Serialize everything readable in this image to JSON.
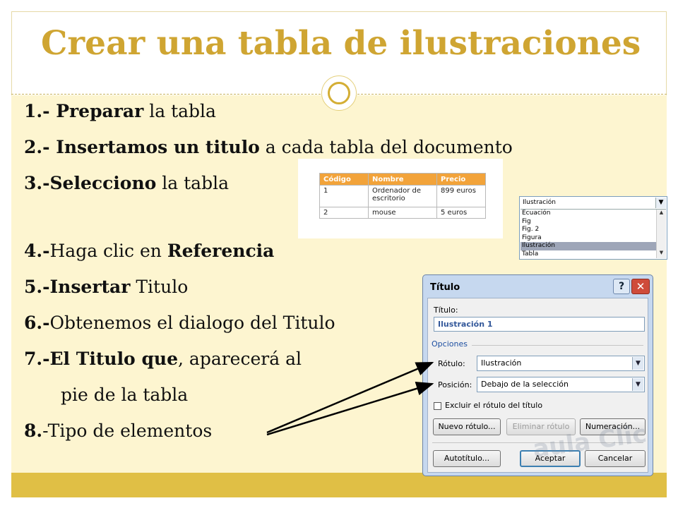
{
  "slide": {
    "title": "Crear una tabla de ilustraciones",
    "items": [
      {
        "number": "1.- ",
        "bold": "Preparar",
        "text": " la tabla"
      },
      {
        "number": "2.- ",
        "bold": "Insertamos un titulo",
        "text": " a cada tabla del documento"
      },
      {
        "number": "3.-",
        "bold": "Selecciono",
        "text": " la tabla"
      },
      {
        "number": "4.-",
        "text": "Haga clic en ",
        "bold_after": "Referencia"
      },
      {
        "number": "5.-",
        "bold": "Insertar",
        "text": " Titulo"
      },
      {
        "number": "6.-",
        "text": "Obtenemos el dialogo del Titulo"
      },
      {
        "number": "7.-",
        "bold": "El Titulo que",
        "text": ", aparecerá al"
      },
      {
        "text": "pie de la tabla"
      },
      {
        "number": "8.",
        "text": "-Tipo de elementos"
      }
    ]
  },
  "example_table": {
    "headers": [
      "Código",
      "Nombre",
      "Precio"
    ],
    "rows": [
      [
        "1",
        "Ordenador de escritorio",
        "899 euros"
      ],
      [
        "2",
        "mouse",
        "5 euros"
      ]
    ]
  },
  "label_list": {
    "selected_value": "Ilustración",
    "options": [
      "Ecuación",
      "Fig",
      "Fig. 2",
      "Figura",
      "Ilustración",
      "Tabla"
    ],
    "selected_index": 4
  },
  "dialog": {
    "title": "Título",
    "help": "?",
    "close": "✕",
    "titulo_label": "Título:",
    "titulo_value": "Ilustración 1",
    "opciones_label": "Opciones",
    "rotulo_label": "Rótulo:",
    "rotulo_value": "Ilustración",
    "posicion_label": "Posición:",
    "posicion_value": "Debajo de la selección",
    "exclude_label": "Excluir el rótulo del título",
    "new_label_button": "Nuevo rótulo...",
    "delete_label_button": "Eliminar rótulo",
    "numbering_button": "Numeración...",
    "autocaption_button": "Autotítulo...",
    "ok_button": "Aceptar",
    "cancel_button": "Cancelar",
    "watermark": "aula Clic"
  },
  "colors": {
    "title": "#cfa532",
    "content_bg": "#fdf5d0",
    "footer_band": "#e0bf45",
    "table_header": "#f2a33a"
  }
}
